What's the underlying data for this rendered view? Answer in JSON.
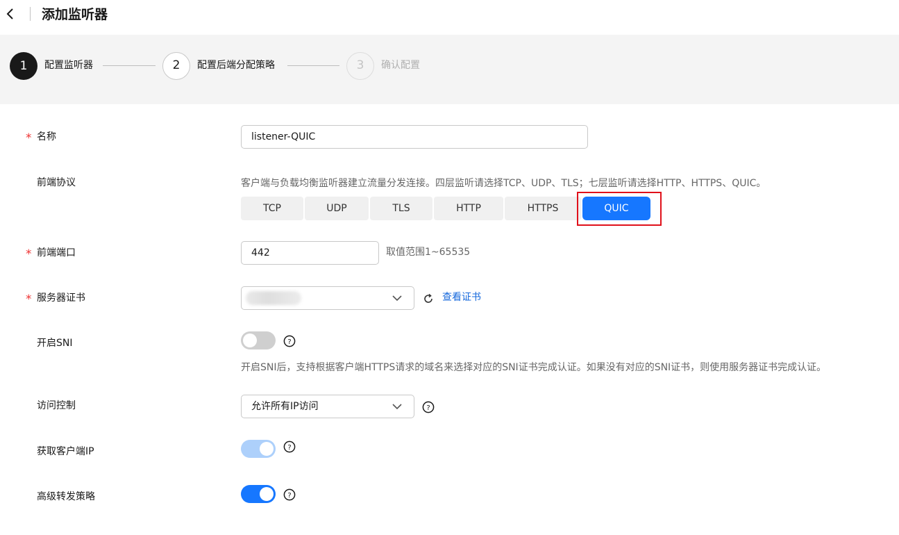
{
  "header": {
    "title": "添加监听器"
  },
  "steps": [
    {
      "number": "1",
      "label": "配置监听器",
      "state": "active"
    },
    {
      "number": "2",
      "label": "配置后端分配策略",
      "state": "todo"
    },
    {
      "number": "3",
      "label": "确认配置",
      "state": "disabled"
    }
  ],
  "form": {
    "name": {
      "label": "名称",
      "required": "*",
      "value": "listener-QUIC"
    },
    "protocol": {
      "label": "前端协议",
      "description": "客户端与负载均衡监听器建立流量分发连接。四层监听请选择TCP、UDP、TLS；七层监听请选择HTTP、HTTPS、QUIC。",
      "options": [
        "TCP",
        "UDP",
        "TLS",
        "HTTP",
        "HTTPS",
        "QUIC"
      ],
      "selected": "QUIC"
    },
    "port": {
      "label": "前端端口",
      "required": "*",
      "value": "442",
      "hint": "取值范围1~65535"
    },
    "certificate": {
      "label": "服务器证书",
      "required": "*",
      "view_link": "查看证书"
    },
    "sni": {
      "label": "开启SNI",
      "enabled": false,
      "description": "开启SNI后，支持根据客户端HTTPS请求的域名来选择对应的SNI证书完成认证。如果没有对应的SNI证书，则使用服务器证书完成认证。"
    },
    "access_control": {
      "label": "访问控制",
      "value": "允许所有IP访问"
    },
    "client_ip": {
      "label": "获取客户端IP",
      "enabled": true,
      "disabled": true
    },
    "advanced_forwarding": {
      "label": "高级转发策略",
      "enabled": true
    }
  },
  "colors": {
    "primary": "#1677ff",
    "highlight": "#e0101a",
    "required": "#e33333"
  }
}
